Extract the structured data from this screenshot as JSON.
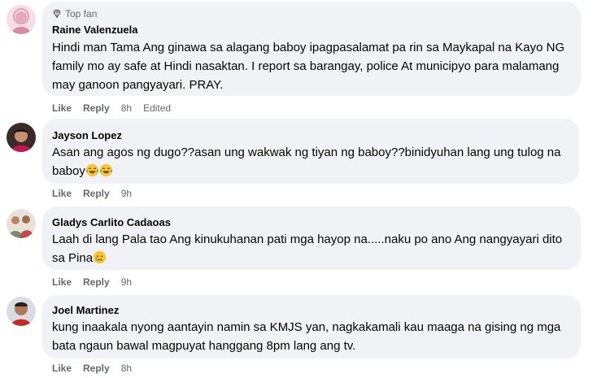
{
  "comments": [
    {
      "badge": "Top fan",
      "author": "Raine Valenzuela",
      "text": "Hindi man Tama Ang ginawa sa alagang baboy ipagpasalamat pa rin sa Maykapal na Kayo NG family mo ay safe at Hindi nasaktan. I report sa barangay, police At municipyo para malamang may ganoon pangyayari. PRAY.",
      "like": "Like",
      "reply": "Reply",
      "time": "8h",
      "edited": "Edited"
    },
    {
      "author": "Jayson Lopez",
      "text": "Asan ang agos ng dugo??asan ung wakwak ng tiyan ng baboy??binidyuhan lang ung tulog na baboy",
      "emojis": [
        "laughing-tears",
        "laughing-tears"
      ],
      "like": "Like",
      "reply": "Reply",
      "time": "9h"
    },
    {
      "author": "Gladys Carlito Cadaoas",
      "text": "Laah di lang Pala tao Ang kinukuhanan pati mga hayop na.....naku po ano Ang nangyayari dito sa Pina",
      "emojis": [
        "sad-tear"
      ],
      "like": "Like",
      "reply": "Reply",
      "time": "9h"
    },
    {
      "author": "Joel Martinez",
      "text": "kung inaakala nyong aantayin namin sa KMJS yan, nagkakamali kau maaga na gising ng mga bata ngaun bawal magpuyat hanggang 8pm lang ang tv.",
      "like": "Like",
      "reply": "Reply",
      "time": "8h"
    }
  ],
  "colors": {
    "bubble": "#f0f2f5",
    "secondary_text": "#65676b",
    "primary_text": "#050505"
  }
}
